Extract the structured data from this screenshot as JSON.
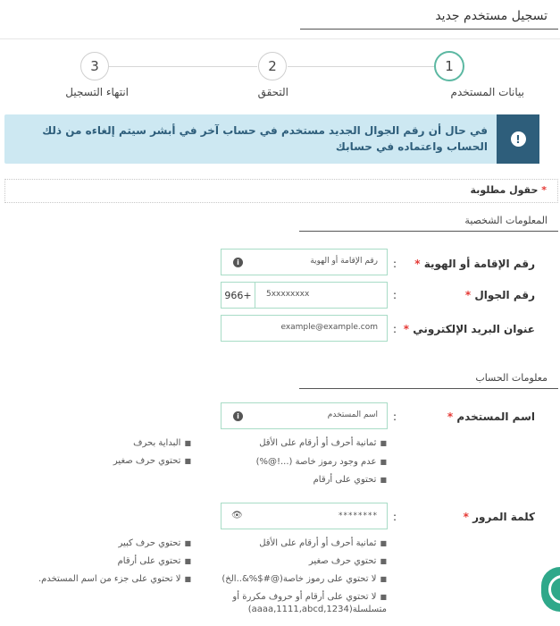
{
  "page": {
    "title": "تسجيل مستخدم جديد"
  },
  "steps": [
    {
      "number": "1",
      "label": "بيانات المستخدم",
      "active": true
    },
    {
      "number": "2",
      "label": "التحقق",
      "active": false
    },
    {
      "number": "3",
      "label": "انتهاء التسجيل",
      "active": false
    }
  ],
  "alert": {
    "icon": "info-exclamation-icon",
    "text": "في حال أن رقم الجوال الجديد مستخدم في حساب آخر في أبشر سيتم إلغاءه من ذلك الحساب واعتماده في حسابك"
  },
  "required_note": {
    "star": "*",
    "text": "حقول مطلوبة"
  },
  "personal": {
    "section_title": "المعلومات الشخصية",
    "id_number": {
      "label": "رقم الإقامة أو الهوية",
      "star": "*",
      "colon": ":",
      "placeholder": "رقم الإقامة أو الهوية"
    },
    "mobile": {
      "label": "رقم الجوال",
      "star": "*",
      "colon": ":",
      "prefix": "+966",
      "placeholder": "5xxxxxxxx"
    },
    "email": {
      "label": "عنوان البريد الإلكتروني",
      "star": "*",
      "colon": ":",
      "placeholder": "example@example.com"
    }
  },
  "account": {
    "section_title": "معلومات الحساب",
    "username": {
      "label": "اسم المستخدم",
      "star": "*",
      "colon": ":",
      "placeholder": "اسم المستخدم",
      "rules_col1": [
        "ثمانية أحرف أو أرقام على الأقل",
        "عدم وجود رموز خاصة (...!@%)",
        "تحتوي على أرقام"
      ],
      "rules_col2": [
        "البداية بحرف",
        "تحتوي حرف صغير"
      ]
    },
    "password": {
      "label": "كلمة المرور",
      "star": "*",
      "colon": ":",
      "value": "********",
      "rules_col1": [
        "ثمانية أحرف أو أرقام على الأقل",
        "تحتوي حرف صغير",
        "لا تحتوي على رموز خاصة(@#$%&..الخ)"
      ],
      "rule_last_line1": "لا تحتوي على أرقام أو حروف مكررة أو",
      "rule_last_line2": "متسلسلة(aaaa,1111,abcd,1234)",
      "rules_col2": [
        "تحتوي حرف كبير",
        "تحتوي على أرقام",
        "لا تحتوي على جزء من اسم المستخدم."
      ]
    }
  },
  "colors": {
    "accent": "#5cb8a2",
    "alert_bg": "#cde8f2",
    "alert_dark": "#2e5e7b",
    "required": "#e53935"
  }
}
